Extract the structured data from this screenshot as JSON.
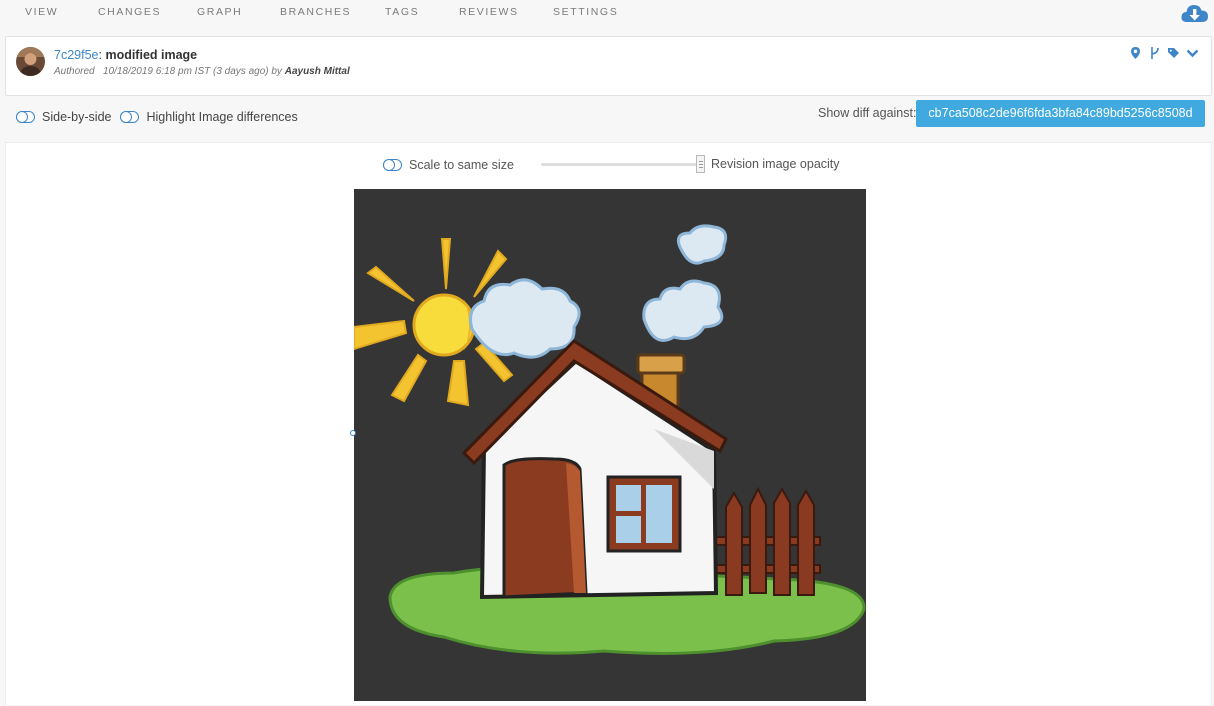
{
  "nav": {
    "tabs": [
      "VIEW",
      "CHANGES",
      "GRAPH",
      "BRANCHES",
      "TAGS",
      "REVIEWS",
      "SETTINGS"
    ],
    "download_icon": "cloud-download-icon"
  },
  "commit": {
    "hash": "7c29f5e",
    "separator": ":",
    "message": "modified image",
    "authored_label": "Authored",
    "date": "10/18/2019 6:18 pm IST (3 days ago) by",
    "author": "Aayush Mittal",
    "icons": [
      "location-pin-icon",
      "branch-icon",
      "tag-icon",
      "chevron-down-icon"
    ]
  },
  "toggles": {
    "side_by_side": "Side-by-side",
    "highlight": "Highlight Image differences"
  },
  "diff": {
    "label": "Show diff against:",
    "revision": "cb7ca508c2de96f6fda3bfa84c89bd5256c8508d"
  },
  "viewer": {
    "scale_label": "Scale to same size",
    "opacity_label": "Revision image opacity",
    "opacity_value": 1.0
  },
  "colors": {
    "accent": "#3f86c9",
    "button": "#3fa9e0"
  }
}
